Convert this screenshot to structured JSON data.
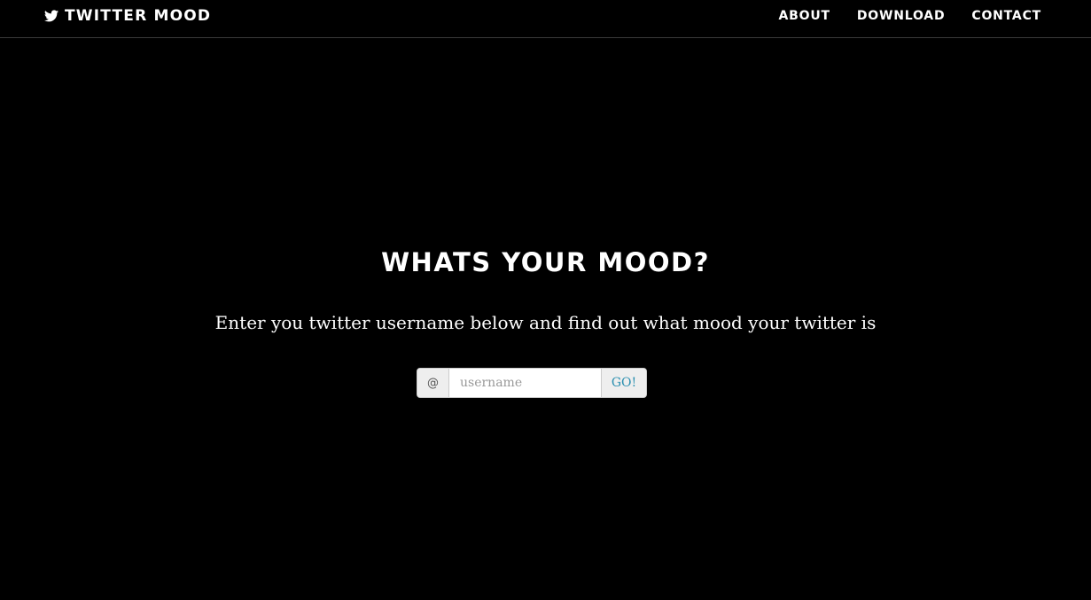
{
  "colors": {
    "background": "#000000",
    "text": "#ffffff",
    "accent_link": "#2a8fb0",
    "addon_background": "#eeeeee"
  },
  "navbar": {
    "brand": {
      "icon": "twitter-bird-icon",
      "label": "TWITTER MOOD"
    },
    "links": [
      {
        "label": "ABOUT"
      },
      {
        "label": "DOWNLOAD"
      },
      {
        "label": "CONTACT"
      }
    ]
  },
  "hero": {
    "title": "WHATS YOUR MOOD?",
    "subtitle": "Enter you twitter username below and find out what mood your twitter is"
  },
  "search": {
    "prefix": "@",
    "placeholder": "username",
    "value": "",
    "submit_label": "GO!"
  }
}
